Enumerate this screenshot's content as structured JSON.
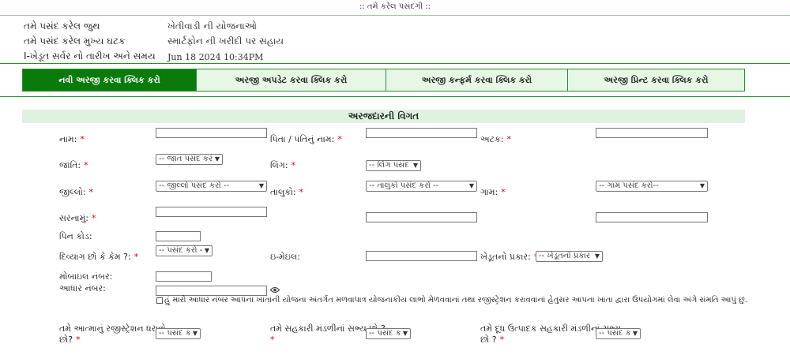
{
  "header": {
    "title": ":: તમે કરેલ પસંદગી ::"
  },
  "info": [
    {
      "label": "તમે પસંદ કરેલ જુથ",
      "value": "ખેતીવાડી ની યોજનાઓ"
    },
    {
      "label": "તમે પસંદ કરેલ મુખ્ય ઘટક",
      "value": "સ્માર્ટફોન ની ખરીદી પર સહાય"
    },
    {
      "label": "I-ખેડૂત સર્વર નો તારીખ અને સમય",
      "value": "Jun 18 2024 10:34PM"
    }
  ],
  "tabs": [
    {
      "label": "નવી અરજી કરવા ક્લિક કરો",
      "active": true
    },
    {
      "label": "અરજી અપડેટ કરવા ક્લિક કરો",
      "active": false
    },
    {
      "label": "અરજી કન્ફર્મ કરવા ક્લિક કરો",
      "active": false
    },
    {
      "label": "અરજી પ્રિન્ટ કરવા ક્લિક કરો",
      "active": false
    }
  ],
  "section": {
    "title": "અરજદારની વિગત"
  },
  "form": {
    "name_label": "નામ:",
    "father_label": "પિતા / પતિનું નામ:",
    "surname_label": "અટક:",
    "caste_label": "જાતિ:",
    "caste_select": "-- જાત પસંદ કરં",
    "gender_label": "લિંગ:",
    "gender_select": "-- લિંગ પસંદ",
    "district_label": "જીલ્લો:",
    "district_select": "-- જીલ્લો પસંદ કરો --",
    "taluka_label": "તાલુકો:",
    "taluka_select": "-- તાલુકો પસંદ કરો --",
    "village_label": "ગામ:",
    "village_select": "-- ગામ પસંદ કરો--",
    "address_label": "સરનામું:",
    "pincode_label": "પિન કોડ:",
    "disabled_label": "દિવ્યાંગ છો કે કેમ ?:",
    "disabled_select": "-- પસંદ કરો -",
    "email_label": "ઇ-મેઇલ:",
    "farmer_type_label": "ખેડૂતનો પ્રકાર:",
    "farmer_type_select": "-- ખેડૂતનો પ્રકાર",
    "mobile_label": "મોબાઇલ નંબર:",
    "aadhar_label": "આધાર નંબર:",
    "consent_text": "હું મારો આધાર નંબર આપના ખાતાની યોજના અંતર્ગત મળવાપાત્ર યોજનાકીય લાભો મેળવવાનાં તથા રજીસ્ટ્રેશન કરાવવાનાં હેતુસર આપના ખાતા દ્વારા ઉપયોગમાં લેવા અંગે સંમતિ આપું છું.",
    "atma_label_1": "તમે આત્માનું રજીસ્ટ્રેશન ધરાવો",
    "atma_label_2": "છો?",
    "atma_select": "-- પસંદ ક",
    "coop_label": "તમે સહકારી મંડળીનાં સભ્ય છો ?",
    "coop_select": "-- પસંદ ક",
    "dairy_label_1": "તમે દૂધ ઉત્પાદક સહકારી મંડળીનાં સભ્ય",
    "dairy_label_2": "છો ?",
    "dairy_select": "-- પસંદ ક",
    "required_mark": "*"
  }
}
